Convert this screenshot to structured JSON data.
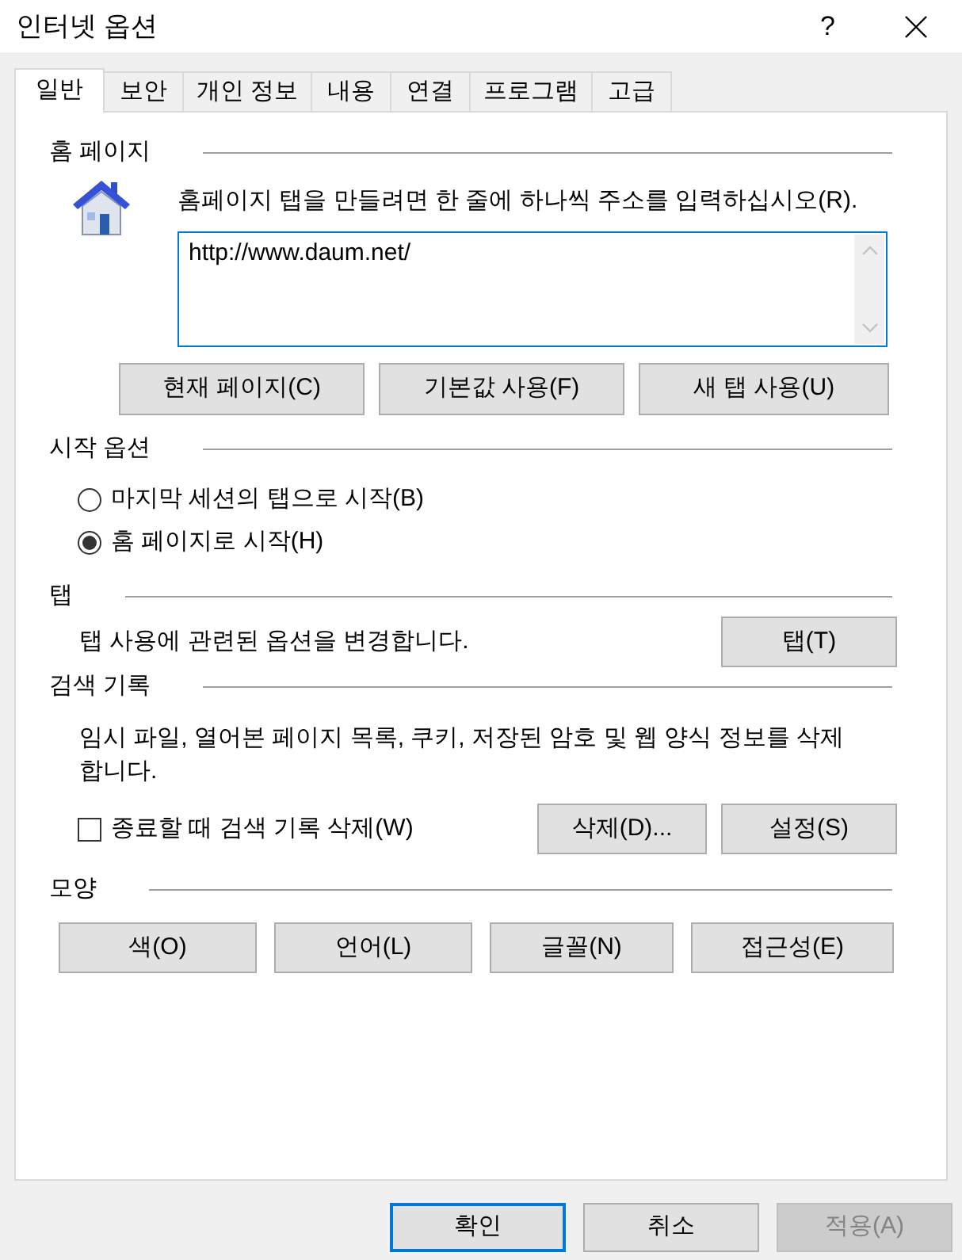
{
  "window": {
    "title": "인터넷 옵션",
    "help": "?"
  },
  "tabs": [
    {
      "label": "일반",
      "selected": true
    },
    {
      "label": "보안",
      "selected": false
    },
    {
      "label": "개인 정보",
      "selected": false
    },
    {
      "label": "내용",
      "selected": false
    },
    {
      "label": "연결",
      "selected": false
    },
    {
      "label": "프로그램",
      "selected": false
    },
    {
      "label": "고급",
      "selected": false
    }
  ],
  "home_page": {
    "heading": "홈 페이지",
    "instruction": "홈페이지 탭을 만들려면 한 줄에 하나씩 주소를 입력하십시오(R).",
    "value": "http://www.daum.net/",
    "buttons": [
      "현재 페이지(C)",
      "기본값 사용(F)",
      "새 탭 사용(U)"
    ]
  },
  "startup": {
    "heading": "시작 옵션",
    "options": [
      {
        "label": "마지막 세션의 탭으로 시작(B)",
        "selected": false
      },
      {
        "label": "홈 페이지로 시작(H)",
        "selected": true
      }
    ]
  },
  "tab_settings": {
    "heading": "탭",
    "description": "탭 사용에 관련된 옵션을 변경합니다.",
    "button": "탭(T)"
  },
  "browsing_history": {
    "heading": "검색 기록",
    "description": "임시 파일, 열어본 페이지 목록, 쿠키, 저장된 암호 및 웹 양식 정보를 삭제합니다.",
    "delete_on_exit": {
      "label": "종료할 때 검색 기록 삭제(W)",
      "checked": false
    },
    "buttons": [
      "삭제(D)...",
      "설정(S)"
    ]
  },
  "appearance": {
    "heading": "모양",
    "buttons": [
      "색(O)",
      "언어(L)",
      "글꼴(N)",
      "접근성(E)"
    ]
  },
  "dialog_buttons": [
    {
      "label": "확인",
      "default": true,
      "disabled": false
    },
    {
      "label": "취소",
      "default": false,
      "disabled": false
    },
    {
      "label": "적용(A)",
      "default": false,
      "disabled": true
    }
  ]
}
